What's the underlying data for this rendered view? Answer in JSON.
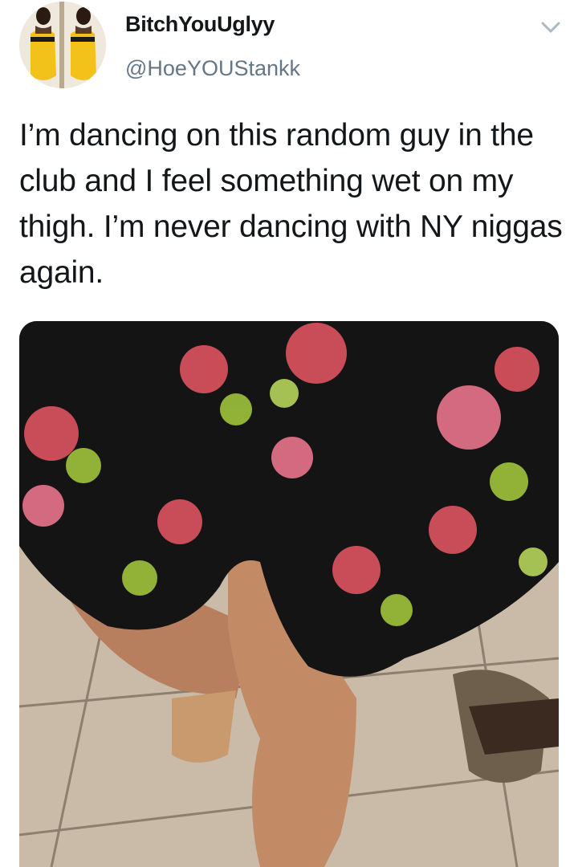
{
  "tweet": {
    "display_name": "BitchYouUglyy",
    "handle": "@HoeYOUStankk",
    "text": "I’m dancing on this random guy in the club and I feel something wet on my thigh. I’m never dancing with NY niggas again."
  },
  "icons": {
    "menu": "chevron-down-icon"
  },
  "colors": {
    "name": "#14171a",
    "handle": "#657786",
    "caret": "#aab8c2",
    "avatar_dress": "#f2c21b"
  }
}
